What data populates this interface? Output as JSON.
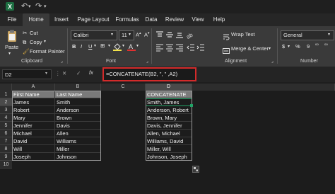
{
  "ribbon_tabs": [
    "File",
    "Home",
    "Insert",
    "Page Layout",
    "Formulas",
    "Data",
    "Review",
    "View",
    "Help"
  ],
  "clipboard": {
    "paste": "Paste",
    "cut": "Cut",
    "copy": "Copy",
    "format_painter": "Format Painter",
    "group": "Clipboard"
  },
  "font": {
    "name": "Calibri",
    "size": "11",
    "group": "Font",
    "bold": "B",
    "italic": "I",
    "underline": "U"
  },
  "alignment": {
    "wrap": "Wrap Text",
    "merge": "Merge & Center",
    "group": "Alignment"
  },
  "number": {
    "format": "General",
    "currency": "$",
    "percent": "%",
    "comma": "9",
    "group": "Number"
  },
  "formula_bar": {
    "name_box": "D2",
    "cancel": "✕",
    "enter": "✓",
    "fx": "fx",
    "formula": "=CONCATENATE(B2, \", \" ,A2)"
  },
  "columns": [
    "A",
    "B",
    "C",
    "D"
  ],
  "rows": [
    "1",
    "2",
    "3",
    "4",
    "5",
    "6",
    "7",
    "8",
    "9",
    "10"
  ],
  "first_names": [
    "First Name",
    "James",
    "Robert",
    "Mary",
    "Jennifer",
    "Michael",
    "David",
    "Will",
    "Joseph"
  ],
  "last_names": [
    "Last Name",
    "Smith",
    "Anderson",
    "Brown",
    "Davis",
    "Allen",
    "Williams",
    "Miller",
    "Johnson"
  ],
  "concatenated": [
    "CONCATENATE",
    "Smith, James",
    "Anderson, Robert",
    "Brown, Mary",
    "Davis, Jennifer",
    "Allen, Michael",
    "Williams, David",
    "Miller, Will",
    "Johnson, Joseph"
  ],
  "colors": {
    "accent_green": "#21a366",
    "highlight_red": "#d42a2a",
    "header_fill": "#7a7a7a"
  }
}
